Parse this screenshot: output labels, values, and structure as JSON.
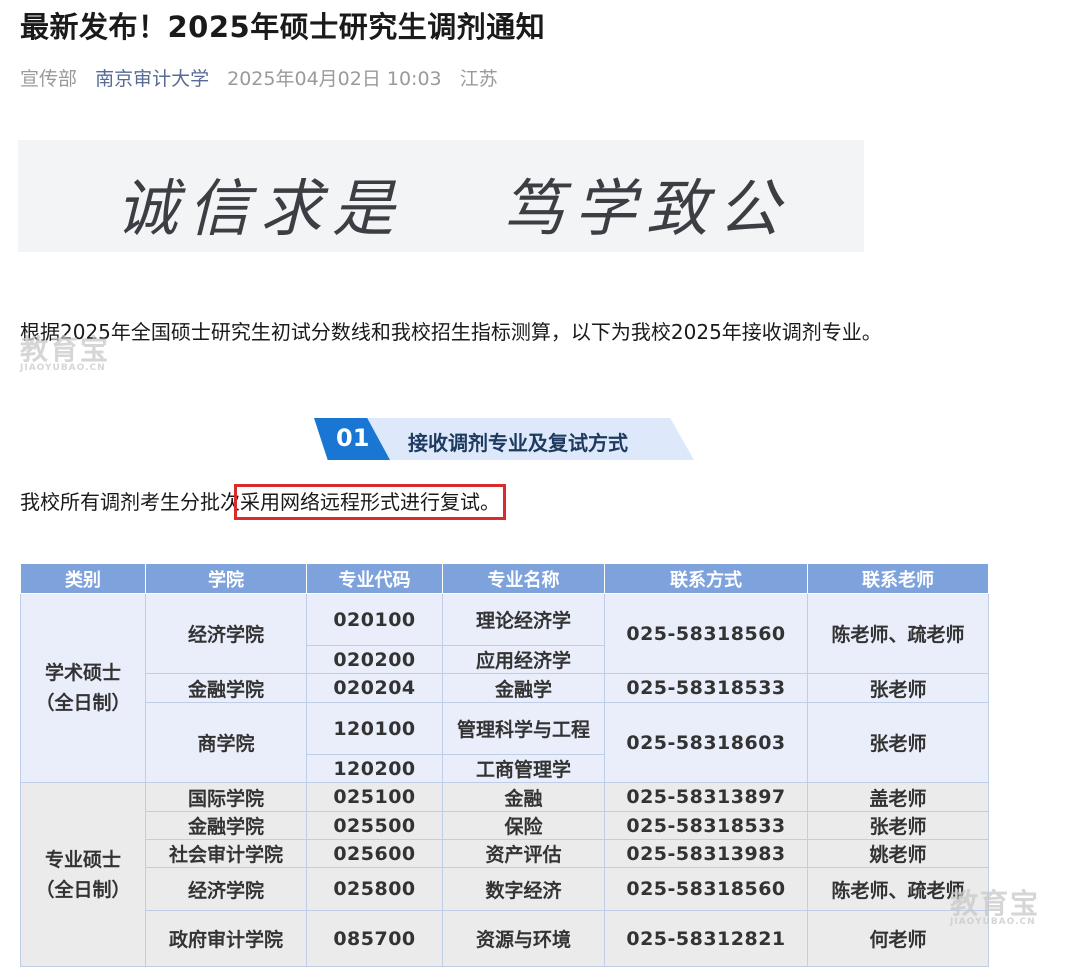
{
  "article": {
    "title": "最新发布！2025年硕士研究生调剂通知",
    "meta": {
      "department": "宣传部",
      "author": "南京审计大学",
      "datetime": "2025年04月02日 10:03",
      "location": "江苏"
    },
    "banner": {
      "motto_left": "诚信求是",
      "motto_right": "笃学致公"
    },
    "intro": "根据2025年全国硕士研究生初试分数线和我校招生指标测算，以下为我校2025年接收调剂专业。",
    "watermark": {
      "brand": "教育宝",
      "domain": "JIAOYUBAO.CN"
    },
    "section": {
      "number": "01",
      "title": "接收调剂专业及复试方式"
    },
    "retest": {
      "prefix": "我校所有调剂考生分批次",
      "highlight": "采用网络远程形式进行复试。"
    },
    "table": {
      "headers": [
        "类别",
        "学院",
        "专业代码",
        "专业名称",
        "联系方式",
        "联系老师"
      ],
      "academic": {
        "category": "学术硕士",
        "mode": "（全日制）",
        "rows": [
          {
            "college": "经济学院",
            "code": "020100",
            "major": "理论经济学",
            "phone": "025-58318560",
            "teacher": "陈老师、疏老师"
          },
          {
            "code": "020200",
            "major": "应用经济学"
          },
          {
            "college": "金融学院",
            "code": "020204",
            "major": "金融学",
            "phone": "025-58318533",
            "teacher": "张老师"
          },
          {
            "college": "商学院",
            "code": "120100",
            "major": "管理科学与工程",
            "phone": "025-58318603",
            "teacher": "张老师"
          },
          {
            "code": "120200",
            "major": "工商管理学"
          }
        ]
      },
      "professional": {
        "category": "专业硕士",
        "mode": "（全日制）",
        "rows": [
          {
            "college": "国际学院",
            "code": "025100",
            "major": "金融",
            "phone": "025-58313897",
            "teacher": "盖老师"
          },
          {
            "college": "金融学院",
            "code": "025500",
            "major": "保险",
            "phone": "025-58318533",
            "teacher": "张老师"
          },
          {
            "college": "社会审计学院",
            "code": "025600",
            "major": "资产评估",
            "phone": "025-58313983",
            "teacher": "姚老师"
          },
          {
            "college": "经济学院",
            "code": "025800",
            "major": "数字经济",
            "phone": "025-58318560",
            "teacher": "陈老师、疏老师"
          },
          {
            "college": "政府审计学院",
            "code": "085700",
            "major": "资源与环境",
            "phone": "025-58312821",
            "teacher": "何老师"
          }
        ]
      }
    }
  }
}
